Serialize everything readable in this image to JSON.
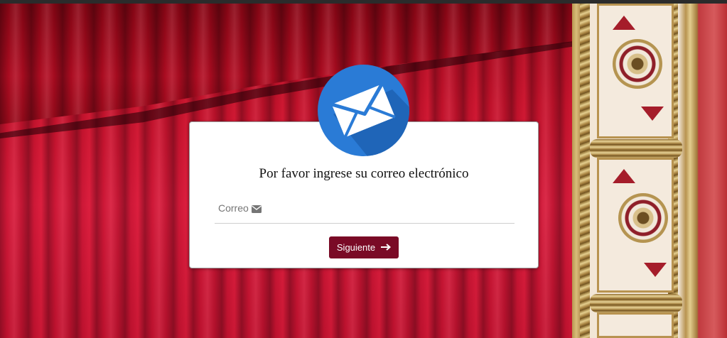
{
  "colors": {
    "accent": "#7a0a26",
    "badge": "#2a7bd6",
    "card_bg": "#ffffff"
  },
  "form": {
    "icon": "envelope-icon",
    "title": "Por favor ingrese su correo electrónico",
    "email_label": "Correo",
    "email_label_icon": "envelope-small-icon",
    "email_value": "",
    "submit_label": "Siguiente",
    "submit_icon": "arrow-right-icon"
  },
  "background": {
    "scene": "theater-curtain"
  }
}
